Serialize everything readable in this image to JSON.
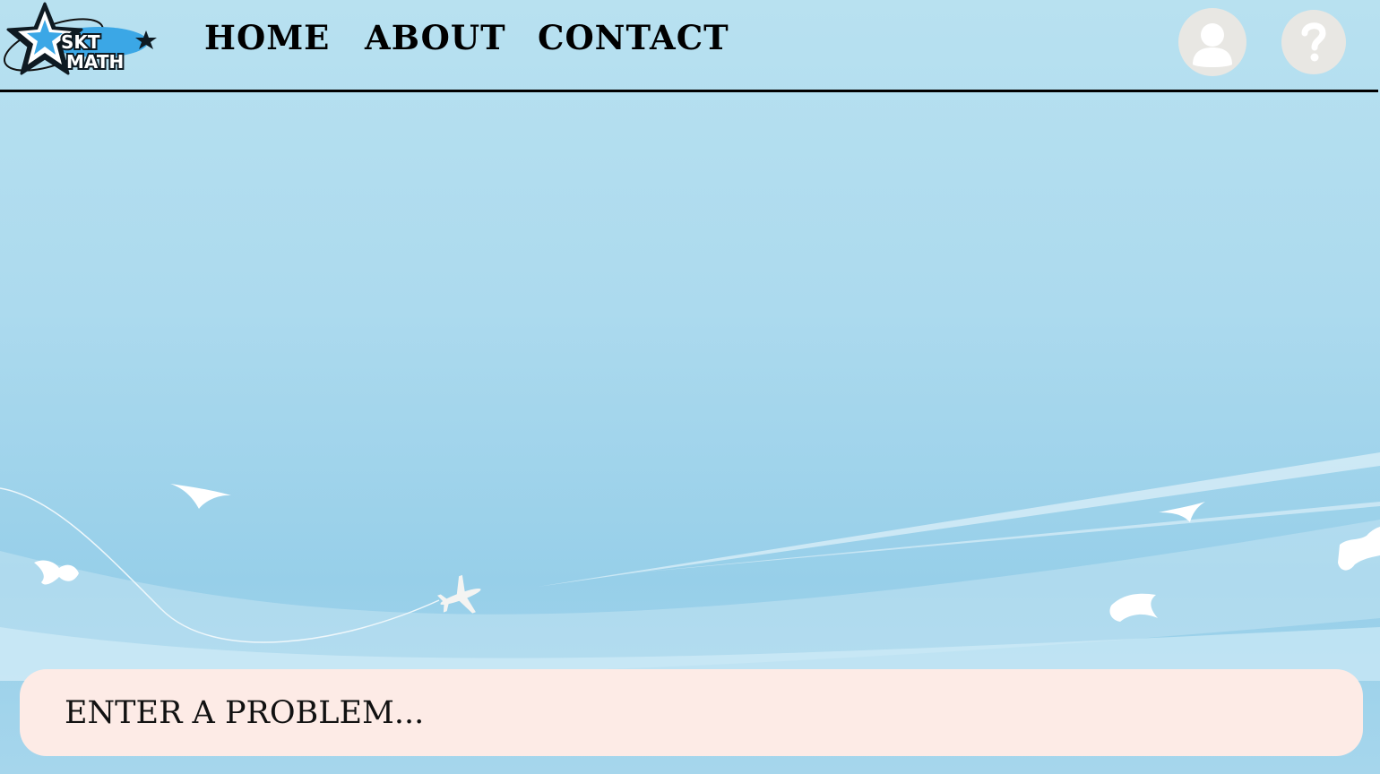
{
  "logo": {
    "line1": "SKT",
    "line2": "MATH"
  },
  "nav": {
    "home": "HOME",
    "about": "ABOUT",
    "contact": "CONTACT"
  },
  "header_icons": {
    "profile": "user-icon",
    "help": "question-mark-icon"
  },
  "problem": {
    "placeholder": "ENTER A PROBLEM..."
  },
  "colors": {
    "sky": "#acdaee",
    "header_border": "#000000",
    "input_bg": "#fdebe6",
    "icon_bg": "#e8e7e3",
    "logo_blue": "#3ba7e6"
  }
}
